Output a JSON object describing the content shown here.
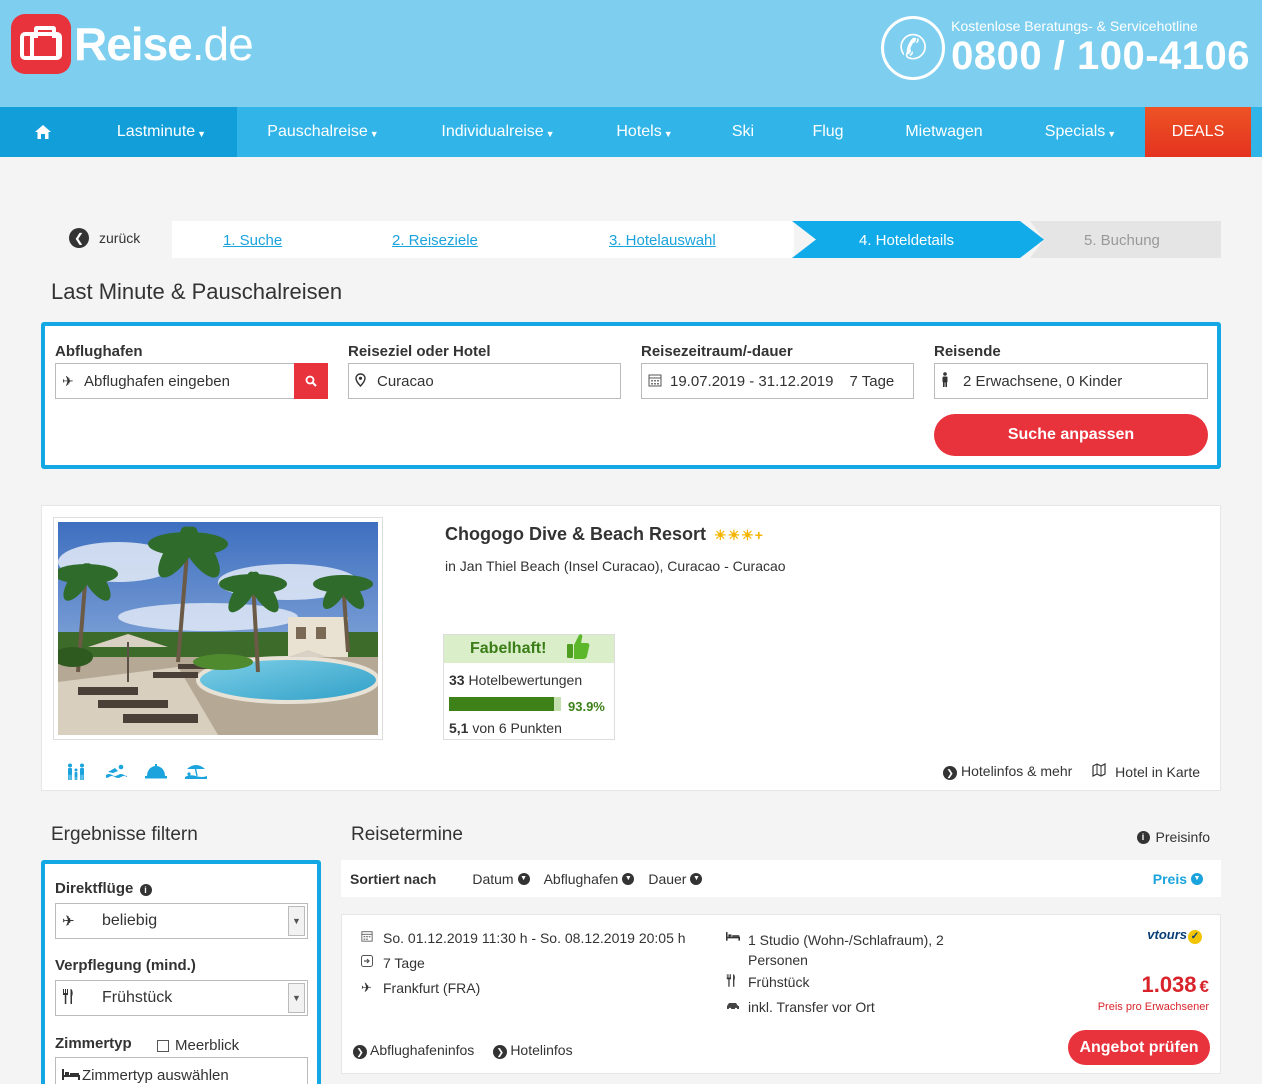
{
  "brand": {
    "logo_main": "Reise",
    "logo_suffix": ".de"
  },
  "hotline": {
    "label": "Kostenlose Beratungs- & Servicehotline",
    "number": "0800 / 100-4106"
  },
  "nav": {
    "home_icon": "home-icon",
    "items": [
      {
        "label": "Lastminute",
        "dropdown": true
      },
      {
        "label": "Pauschalreise",
        "dropdown": true
      },
      {
        "label": "Individualreise",
        "dropdown": true
      },
      {
        "label": "Hotels",
        "dropdown": true
      },
      {
        "label": "Ski",
        "dropdown": false
      },
      {
        "label": "Flug",
        "dropdown": false
      },
      {
        "label": "Mietwagen",
        "dropdown": false
      },
      {
        "label": "Specials",
        "dropdown": true
      },
      {
        "label": "DEALS",
        "dropdown": false
      }
    ]
  },
  "steps": {
    "back": "zurück",
    "items": [
      "1. Suche",
      "2. Reiseziele",
      "3. Hotelauswahl",
      "4. Hoteldetails",
      "5. Buchung"
    ]
  },
  "page_title": "Last Minute & Pauschalreisen",
  "search": {
    "departure_label": "Abflughafen",
    "departure_placeholder": "Abflughafen eingeben",
    "destination_label": "Reiseziel oder Hotel",
    "destination_value": "Curacao",
    "period_label": "Reisezeitraum/-dauer",
    "period_dates": "19.07.2019 - 31.12.2019",
    "period_duration": "7 Tage",
    "travellers_label": "Reisende",
    "travellers_value": "2 Erwachsene, 0 Kinder",
    "submit_label": "Suche anpassen"
  },
  "hotel": {
    "name": "Chogogo Dive & Beach Resort",
    "stars": "☀☀☀+",
    "location": "in Jan Thiel Beach (Insel Curacao), Curacao - Curacao",
    "rating_label": "Fabelhaft!",
    "reviews_count": "33",
    "reviews_label": "Hotelbewertungen",
    "recommend_pct": "93.9%",
    "recommend_fraction": 0.939,
    "score": "5,1",
    "score_suffix": "von 6 Punkten",
    "amenity_icons": [
      "family-icon",
      "swimming-icon",
      "service-bell-icon",
      "beach-icon"
    ],
    "link_info": "Hotelinfos & mehr",
    "link_map": "Hotel in Karte"
  },
  "filter": {
    "title": "Ergebnisse filtern",
    "direct_label": "Direktflüge",
    "direct_value": "beliebig",
    "board_label": "Verpflegung (mind.)",
    "board_value": "Frühstück",
    "room_label": "Zimmertyp",
    "seaview_label": "Meerblick",
    "room_placeholder": "Zimmertyp auswählen"
  },
  "results": {
    "title": "Reisetermine",
    "price_info": "Preisinfo",
    "sort_label": "Sortiert nach",
    "sort_options": [
      "Datum",
      "Abflughafen",
      "Dauer"
    ],
    "sort_active": "Preis"
  },
  "offer": {
    "dates": "So. 01.12.2019 11:30 h - So. 08.12.2019 20:05 h",
    "duration": "7 Tage",
    "airport": "Frankfurt (FRA)",
    "room_line1": "1 Studio (Wohn-/Schlafraum), 2",
    "room_line2": "Personen",
    "board": "Frühstück",
    "transfer": "inkl. Transfer vor Ort",
    "operator": "vtours",
    "price": "1.038",
    "currency": "€",
    "price_note": "Preis pro Erwachsener",
    "cta": "Angebot prüfen",
    "link_airport": "Abflughafeninfos",
    "link_hotel": "Hotelinfos"
  }
}
